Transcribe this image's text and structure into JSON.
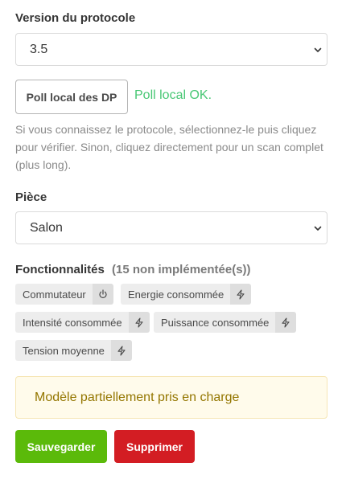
{
  "protocol": {
    "label": "Version du protocole",
    "selected": "3.5"
  },
  "poll": {
    "button_label": "Poll local des DP",
    "status": "Poll local OK."
  },
  "help_text": {
    "line1": "Si vous connaissez le protocole, sélectionnez-le puis cliquez",
    "line2": "pour vérifier. Sinon, cliquez directement pour un scan complet",
    "line3": "(plus long)."
  },
  "room": {
    "label": "Pièce",
    "selected": "Salon"
  },
  "features": {
    "label": "Fonctionnalités",
    "count_note": "(15 non implémentée(s))",
    "tags": [
      {
        "name": "Commutateur",
        "icon": "power-icon"
      },
      {
        "name": "Energie consommée",
        "icon": "bolt-icon"
      },
      {
        "name": "Intensité consommée",
        "icon": "bolt-icon"
      },
      {
        "name": "Puissance consommée",
        "icon": "bolt-icon"
      },
      {
        "name": "Tension moyenne",
        "icon": "bolt-icon"
      }
    ]
  },
  "notice": {
    "text": "Modèle partiellement pris en charge"
  },
  "actions": {
    "save_label": "Sauvegarder",
    "delete_label": "Supprimer"
  },
  "colors": {
    "ok_green": "#48c774",
    "save_green": "#5bba0a",
    "delete_red": "#d31d23",
    "notice_bg": "#fffbeb",
    "notice_text": "#947600"
  }
}
